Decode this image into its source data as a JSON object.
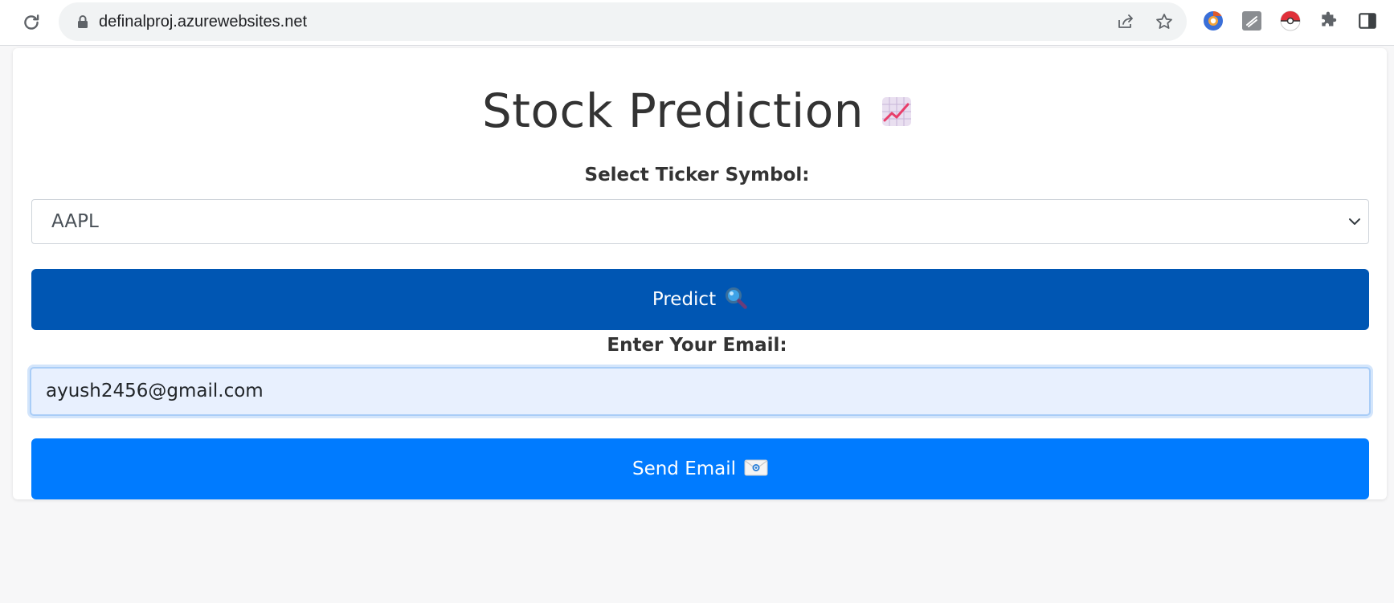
{
  "browser": {
    "url": "definalproj.azurewebsites.net",
    "icons": [
      "reload-icon",
      "lock-icon",
      "share-icon",
      "star-icon",
      "extension-chromium-icon",
      "extension-note-icon",
      "extension-pokeball-icon",
      "extensions-puzzle-icon",
      "side-panel-icon"
    ]
  },
  "page": {
    "title": "Stock Prediction",
    "title_emoji": "chart-increasing-icon",
    "ticker_label": "Select Ticker Symbol:",
    "ticker_value": "AAPL",
    "predict_label": "Predict",
    "predict_icon": "magnifier-icon",
    "email_label": "Enter Your Email:",
    "email_value": "ayush2456@gmail.com",
    "send_label": "Send Email",
    "send_icon": "envelope-icon"
  },
  "colors": {
    "predict_button": "#0056b3",
    "send_button": "#007bff",
    "email_field_bg": "#e8f0fe",
    "page_bg": "#f7f7f8"
  }
}
